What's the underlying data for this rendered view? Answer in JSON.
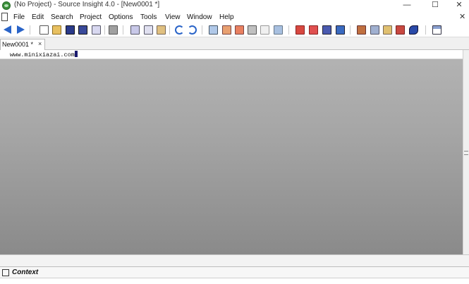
{
  "window": {
    "title": "(No Project) - Source Insight 4.0 - [New0001 *]",
    "minimize": "—",
    "maximize": "☐",
    "close": "✕"
  },
  "menubar": {
    "items": [
      "File",
      "Edit",
      "Search",
      "Project",
      "Options",
      "Tools",
      "View",
      "Window",
      "Help"
    ],
    "close": "✕"
  },
  "toolbar": {
    "icons": [
      "back-arrow-icon",
      "forward-arrow-icon",
      "new-file-icon",
      "open-folder-icon",
      "save-icon",
      "save-all-icon",
      "properties-icon",
      "print-icon",
      "cut-icon",
      "copy-icon",
      "paste-icon",
      "undo-icon",
      "redo-icon",
      "browse-icon",
      "jump-up-icon",
      "jump-down-icon",
      "lookup-icon",
      "symbol-window-icon",
      "relation-icon",
      "bookmark-icon",
      "bookmark-list-icon",
      "window-toggle-icon",
      "export-icon",
      "project-icon",
      "book-icon",
      "library-icon",
      "sync-icon",
      "rename-icon",
      "layout-icon"
    ],
    "colors": {
      "blue": "#2a64c8",
      "red": "#c83228",
      "green": "#3a8f3a"
    }
  },
  "tabs": [
    {
      "label": "New0001 *",
      "close": "×"
    }
  ],
  "editor": {
    "line_text": "www.minixiazai.com"
  },
  "context_panel": {
    "label": "Context"
  }
}
